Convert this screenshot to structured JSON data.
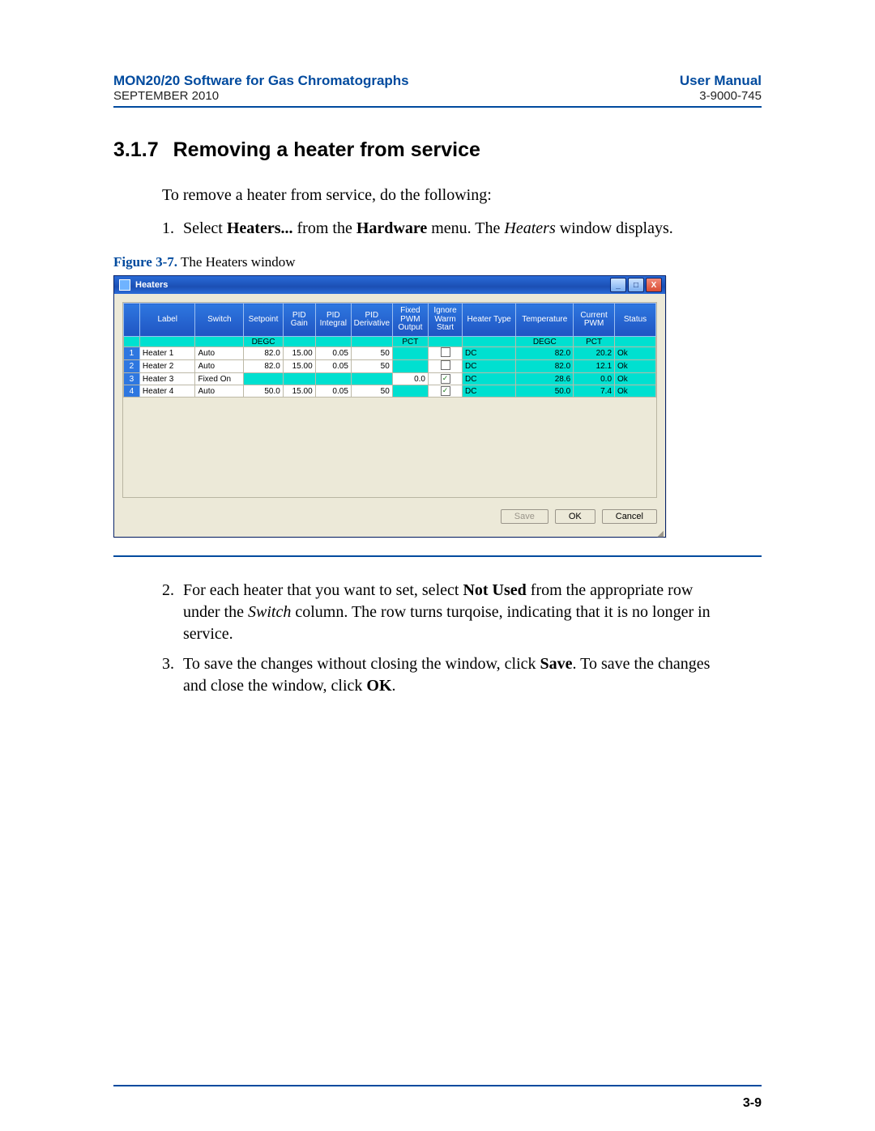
{
  "header": {
    "left": "MON20/20 Software for Gas Chromatographs",
    "right": "User Manual",
    "subleft": "SEPTEMBER 2010",
    "subright": "3-9000-745"
  },
  "section": {
    "num": "3.1.7",
    "title": "Removing a heater from service"
  },
  "intro": "To remove a heater from service, do the following:",
  "steps": {
    "s1_pre": "Select ",
    "s1_b1": "Heaters...",
    "s1_mid": " from the ",
    "s1_b2": "Hardware",
    "s1_mid2": " menu.  The ",
    "s1_i": "Heaters",
    "s1_tail": " window displays.",
    "s2_pre": "For each heater that you want to set, select ",
    "s2_b1": "Not Used",
    "s2_mid": " from the appropriate row under the ",
    "s2_i": "Switch",
    "s2_tail": " column.  The row turns turqoise, indicating that it is no longer in service.",
    "s3_pre": "To save the changes without closing the window, click ",
    "s3_b1": "Save",
    "s3_mid": ". To save the changes and close the window, click ",
    "s3_b2": "OK",
    "s3_tail": "."
  },
  "figure": {
    "lead": "Figure 3-7.",
    "caption": "  The Heaters window"
  },
  "window": {
    "title": "Heaters",
    "min_glyph": "_",
    "max_glyph": "□",
    "close_glyph": "X",
    "columns": [
      "",
      "Label",
      "Switch",
      "Setpoint",
      "PID Gain",
      "PID Integral",
      "PID Derivative",
      "Fixed PWM Output",
      "Ignore Warm Start",
      "Heater Type",
      "Temperature",
      "Current PWM",
      "Status"
    ],
    "units": [
      "",
      "",
      "",
      "DEGC",
      "",
      "",
      "",
      "PCT",
      "",
      "",
      "DEGC",
      "PCT",
      ""
    ],
    "rows": [
      {
        "n": "1",
        "label": "Heater 1",
        "switch": "Auto",
        "setpoint": "82.0",
        "gain": "15.00",
        "integral": "0.05",
        "deriv": "50",
        "fixed": "",
        "ignore": false,
        "type": "DC",
        "temp": "82.0",
        "pwm": "20.2",
        "status": "Ok"
      },
      {
        "n": "2",
        "label": "Heater 2",
        "switch": "Auto",
        "setpoint": "82.0",
        "gain": "15.00",
        "integral": "0.05",
        "deriv": "50",
        "fixed": "",
        "ignore": false,
        "type": "DC",
        "temp": "82.0",
        "pwm": "12.1",
        "status": "Ok"
      },
      {
        "n": "3",
        "label": "Heater 3",
        "switch": "Fixed On",
        "setpoint": "",
        "gain": "",
        "integral": "",
        "deriv": "",
        "fixed": "0.0",
        "ignore": true,
        "type": "DC",
        "temp": "28.6",
        "pwm": "0.0",
        "status": "Ok"
      },
      {
        "n": "4",
        "label": "Heater 4",
        "switch": "Auto",
        "setpoint": "50.0",
        "gain": "15.00",
        "integral": "0.05",
        "deriv": "50",
        "fixed": "",
        "ignore": true,
        "type": "DC",
        "temp": "50.0",
        "pwm": "7.4",
        "status": "Ok"
      }
    ],
    "buttons": {
      "save": "Save",
      "ok": "OK",
      "cancel": "Cancel"
    }
  },
  "pagenum": "3-9"
}
